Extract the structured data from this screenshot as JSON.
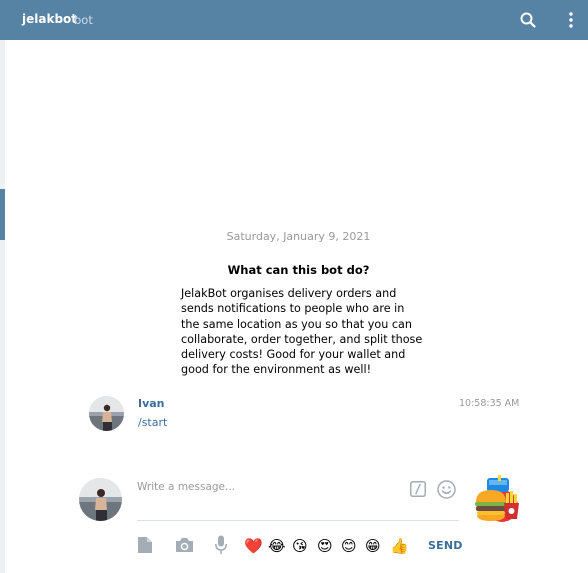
{
  "header": {
    "title": "jelakbot",
    "subtitle": "bot",
    "search_icon": "search-icon",
    "menu_icon": "vertical-dots-icon"
  },
  "chat": {
    "date": "Saturday, January 9, 2021",
    "about_title": "What can this bot do?",
    "about_text": "JelakBot organises delivery orders and sends notifications to people who are in the same location as you so that you can collaborate, order together, and split those delivery costs! Good for your wallet and good for the environment as well!",
    "message": {
      "author": "Ivan",
      "time": "10:58:35 AM",
      "text": "/start"
    }
  },
  "composer": {
    "placeholder": "Write a message...",
    "send_label": "SEND",
    "toolbar_icons": [
      "file-icon",
      "camera-icon",
      "microphone-icon"
    ],
    "quick_emojis": [
      "❤️",
      "😂",
      "😘",
      "😍",
      "😊",
      "😁",
      "👍"
    ]
  },
  "colors": {
    "header_bg": "#5682a3",
    "link": "#3a6d99",
    "muted": "#999999"
  }
}
